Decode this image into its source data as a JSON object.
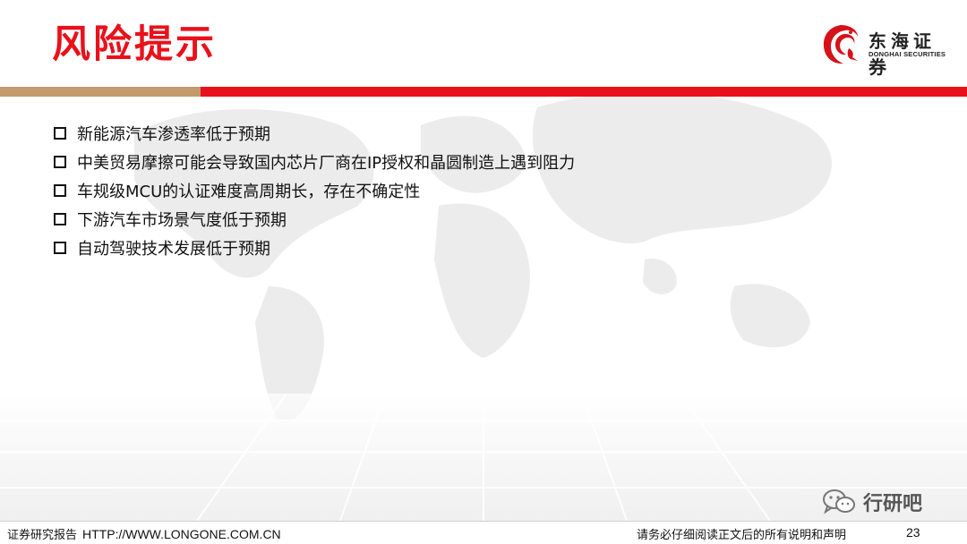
{
  "slide": {
    "title": "风险提示",
    "bullets": [
      "新能源汽车渗透率低于预期",
      "中美贸易摩擦可能会导致国内芯片厂商在IP授权和晶圆制造上遇到阻力",
      "车规级MCU的认证难度高周期长，存在不确定性",
      "下游汽车市场景气度低于预期",
      "自动驾驶技术发展低于预期"
    ],
    "bullet_icon": "hollow-square-icon"
  },
  "logo": {
    "name_cn": "东海证券",
    "name_en": "DONGHAI SECURITIES",
    "icon": "dragon-logo-icon"
  },
  "watermark": {
    "icon": "wechat-icon",
    "text": "行研吧"
  },
  "footer": {
    "report_label": "证券研究报告",
    "url": "HTTP://WWW.LONGONE.COM.CN",
    "disclaimer": "请务必仔细阅读正文后的所有说明和声明",
    "page_number": "23"
  },
  "colors": {
    "accent_red": "#e8111b",
    "accent_tan": "#c39a6b"
  }
}
